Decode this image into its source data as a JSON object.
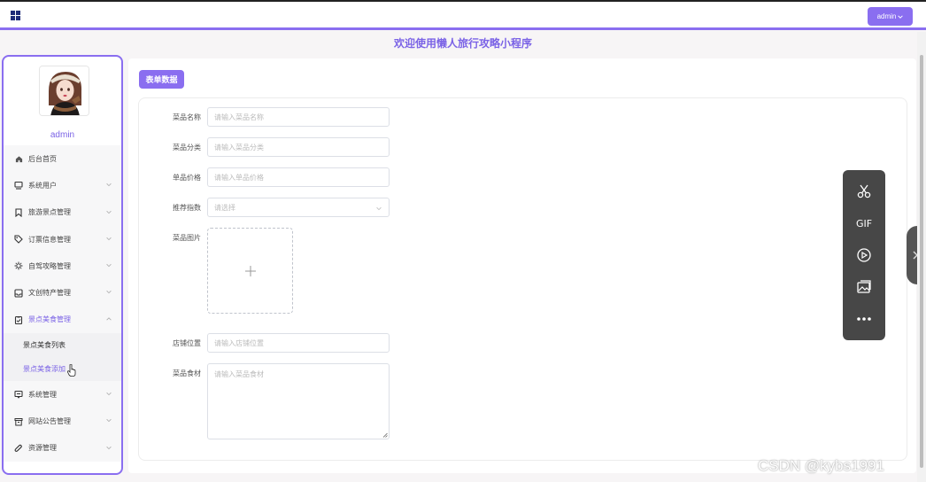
{
  "header": {
    "user_button_label": "admin",
    "welcome_title": "欢迎使用懒人旅行攻略小程序"
  },
  "sidebar": {
    "admin_name": "admin",
    "items": [
      {
        "label": "后台首页",
        "icon": "home-icon"
      },
      {
        "label": "系统用户",
        "icon": "monitor-icon"
      },
      {
        "label": "旅游景点管理",
        "icon": "bookmark-icon"
      },
      {
        "label": "订票信息管理",
        "icon": "tag-icon"
      },
      {
        "label": "自驾攻略管理",
        "icon": "sun-icon"
      },
      {
        "label": "文创特产管理",
        "icon": "inbox-icon"
      },
      {
        "label": "景点美食管理",
        "icon": "clipboard-icon"
      },
      {
        "label": "系统管理",
        "icon": "message-icon"
      },
      {
        "label": "网站公告管理",
        "icon": "archive-icon"
      },
      {
        "label": "资源管理",
        "icon": "paperclip-icon"
      }
    ],
    "subitems": [
      {
        "label": "景点美食列表"
      },
      {
        "label": "景点美食添加"
      }
    ]
  },
  "main": {
    "tag_label": "表单数据",
    "form": {
      "name": {
        "label": "菜品名称",
        "placeholder": "请输入菜品名称"
      },
      "category": {
        "label": "菜品分类",
        "placeholder": "请输入菜品分类"
      },
      "price": {
        "label": "单品价格",
        "placeholder": "请输入单品价格"
      },
      "recommend": {
        "label": "推荐指数",
        "placeholder": "请选择"
      },
      "image": {
        "label": "菜品图片"
      },
      "location": {
        "label": "店铺位置",
        "placeholder": "请输入店铺位置"
      },
      "ingredients": {
        "label": "菜品食材",
        "placeholder": "请输入菜品食材"
      }
    }
  },
  "float_toolbar": {
    "items": [
      "scissors-icon",
      "GIF",
      "record-icon",
      "image-icon",
      "more-icon"
    ],
    "gif_label": "GIF"
  },
  "watermark": "CSDN @kybs1991",
  "colors": {
    "accent": "#8a6ef0",
    "title": "#7b63e6",
    "toolbar_bg": "#474747"
  }
}
